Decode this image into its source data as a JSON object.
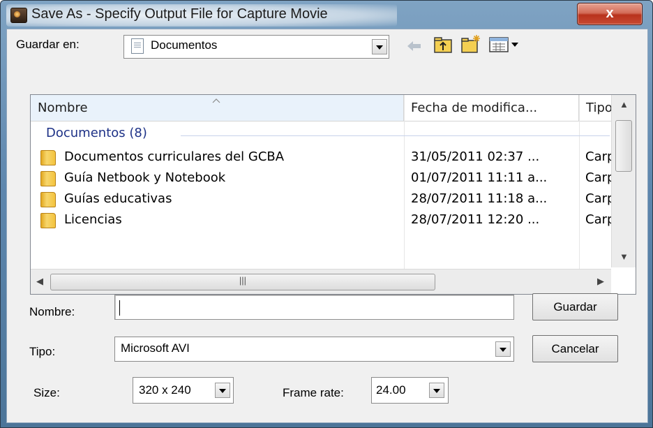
{
  "window": {
    "title": "Save As - Specify Output File for Capture Movie",
    "close_label": "x"
  },
  "location": {
    "label": "Guardar en:",
    "value": "Documentos"
  },
  "toolbar_icons": [
    "back-arrow-icon",
    "up-folder-icon",
    "new-folder-icon",
    "view-menu-icon"
  ],
  "file_list": {
    "columns": [
      "Nombre",
      "Fecha de modifica...",
      "Tipo"
    ],
    "group": "Documentos (8)",
    "rows": [
      {
        "name": "Documentos curriculares del GCBA",
        "date": "31/05/2011 02:37 ...",
        "type": "Carpe"
      },
      {
        "name": "Guía Netbook y Notebook",
        "date": "01/07/2011 11:11 a...",
        "type": "Carpe"
      },
      {
        "name": "Guías educativas",
        "date": "28/07/2011 11:18 a...",
        "type": "Carpe"
      },
      {
        "name": "Licencias",
        "date": "28/07/2011 12:20 ...",
        "type": "Carpe"
      }
    ]
  },
  "filename": {
    "label": "Nombre:",
    "value": ""
  },
  "filetype": {
    "label": "Tipo:",
    "value": "Microsoft AVI"
  },
  "buttons": {
    "save": "Guardar",
    "cancel": "Cancelar"
  },
  "size": {
    "label": "Size:",
    "value": "320 x 240"
  },
  "frame_rate": {
    "label": "Frame rate:",
    "value": "24.00"
  },
  "colors": {
    "title_frame": "#5d86ad",
    "close_button": "#c84a33",
    "group_header": "#1e3287",
    "folder": "#f3c33e"
  }
}
